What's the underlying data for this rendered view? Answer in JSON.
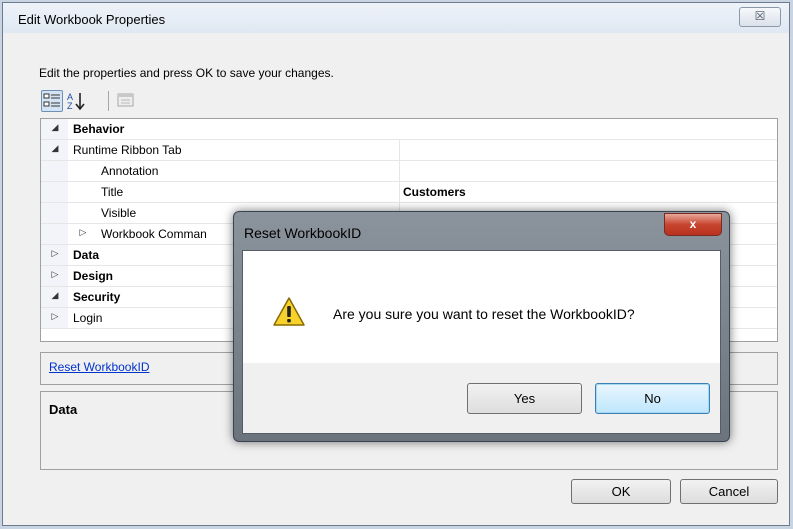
{
  "main_window": {
    "title": "Edit Workbook Properties",
    "close_glyph": "☒",
    "instruction": "Edit the properties and press OK to save your changes.",
    "toolbar": {
      "categorized_icon": "categorized-icon",
      "alphabetical_icon": "sort-alpha-icon",
      "property_pages_icon": "property-pages-icon"
    },
    "grid_rows": [
      {
        "name": "Behavior",
        "value": "",
        "expander": "◢",
        "category": true
      },
      {
        "name": "Runtime Ribbon Tab",
        "value": "",
        "expander": "◢",
        "category": false
      },
      {
        "name": "Annotation",
        "value": "",
        "expander": "",
        "category": false
      },
      {
        "name": "Title",
        "value": "Customers",
        "expander": "",
        "category": false
      },
      {
        "name": "Visible",
        "value": "",
        "expander": "",
        "category": false
      },
      {
        "name": "Workbook Comman",
        "value": "",
        "expander": "▷",
        "category": false
      },
      {
        "name": "Data",
        "value": "",
        "expander": "▷",
        "category": true
      },
      {
        "name": "Design",
        "value": "",
        "expander": "▷",
        "category": true
      },
      {
        "name": "Security",
        "value": "",
        "expander": "◢",
        "category": true
      },
      {
        "name": "Login",
        "value": "",
        "expander": "▷",
        "category": false
      }
    ],
    "reset_link": "Reset WorkbookID",
    "description_title": "Data",
    "ok_label": "OK",
    "cancel_label": "Cancel"
  },
  "modal": {
    "title": "Reset WorkbookID",
    "close_glyph": "x",
    "message": "Are you sure you want to reset the WorkbookID?",
    "icon": "warning-icon",
    "yes_label": "Yes",
    "no_label": "No"
  }
}
